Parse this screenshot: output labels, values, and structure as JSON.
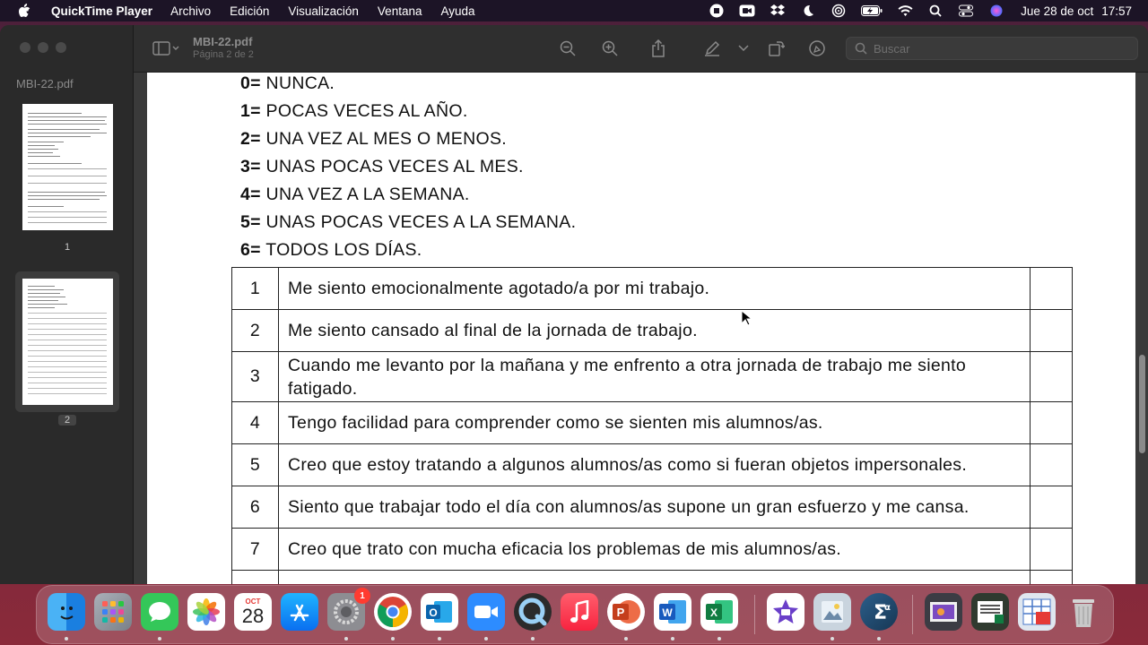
{
  "menubar": {
    "app_name": "QuickTime Player",
    "items": [
      "Archivo",
      "Edición",
      "Visualización",
      "Ventana",
      "Ayuda"
    ],
    "clock_date": "Jue 28 de oct",
    "clock_time": "17:57"
  },
  "sidebar": {
    "title": "MBI-22.pdf",
    "pages": [
      "1",
      "2"
    ]
  },
  "toolbar": {
    "doc_title": "MBI-22.pdf",
    "doc_subtitle": "Página 2 de 2",
    "search_placeholder": "Buscar"
  },
  "document": {
    "scale": [
      {
        "num": "0=",
        "text": " NUNCA."
      },
      {
        "num": "1=",
        "text": " POCAS VECES AL AÑO."
      },
      {
        "num": "2=",
        "text": " UNA VEZ AL MES O MENOS."
      },
      {
        "num": "3=",
        "text": " UNAS POCAS VECES AL MES."
      },
      {
        "num": "4=",
        "text": " UNA VEZ A LA SEMANA."
      },
      {
        "num": "5=",
        "text": " UNAS POCAS VECES A LA SEMANA."
      },
      {
        "num": "6=",
        "text": " TODOS LOS DÍAS."
      }
    ],
    "questions": [
      {
        "num": "1",
        "text": "Me siento emocionalmente agotado/a   por mi trabajo."
      },
      {
        "num": "2",
        "text": "Me siento cansado al final de la jornada de trabajo."
      },
      {
        "num": "3",
        "text": "Cuando me levanto por la mañana y me enfrento a otra jornada de trabajo me siento fatigado."
      },
      {
        "num": "4",
        "text": "Tengo facilidad para comprender como se sienten mis alumnos/as."
      },
      {
        "num": "5",
        "text": "Creo que estoy tratando a algunos alumnos/as  como si fueran objetos impersonales."
      },
      {
        "num": "6",
        "text": "Siento que trabajar todo el día con alumnos/as  supone un gran esfuerzo y me cansa."
      },
      {
        "num": "7",
        "text": "Creo que trato con mucha eficacia los problemas de mis alumnos/as."
      }
    ]
  },
  "dock": {
    "calendar_month": "OCT",
    "calendar_day": "28",
    "settings_badge": "1",
    "apps": [
      "Finder",
      "Launchpad",
      "Messages",
      "Photos",
      "Calendar",
      "App Store",
      "System Preferences",
      "Google Chrome",
      "Outlook",
      "Zoom",
      "QuickTime Player",
      "Music",
      "PowerPoint",
      "Word",
      "Excel",
      "iMovie",
      "Preview",
      "Calculator",
      "Downloads",
      "Documents",
      "Spreadsheet",
      "Trash"
    ]
  }
}
